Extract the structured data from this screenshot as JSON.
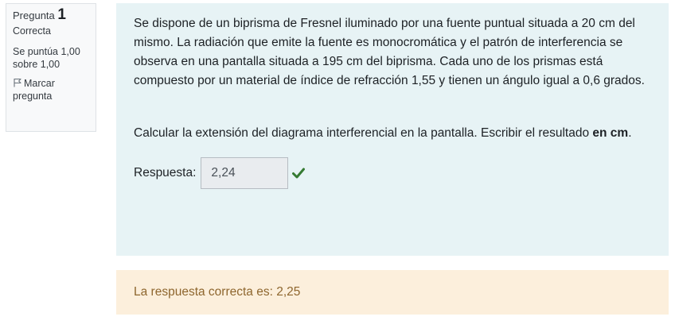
{
  "question_info": {
    "number_label": "Pregunta",
    "number": "1",
    "state": "Correcta",
    "grade": "Se puntúa 1,00 sobre 1,00",
    "flag_label": "Marcar pregunta",
    "flag_icon": "flag-outline-icon"
  },
  "question": {
    "statement": "Se dispone de un biprisma de Fresnel iluminado por una fuente puntual situada a 20 cm del mismo. La radiación que emite la fuente es monocromática y el patrón de interferencia se observa en una pantalla situada a 195 cm del biprisma. Cada uno de los prismas está compuesto por un material de índice de refracción 1,55 y tienen un ángulo igual a 0,6 grados.",
    "task_prefix": "Calcular la extensión del diagrama interferencial en la pantalla. Escribir el resultado ",
    "task_bold": "en cm",
    "task_suffix": ".",
    "answer_label": "Respuesta:",
    "answer_value": "2,24",
    "answer_status_icon": "check-icon",
    "status_color": "#357a32"
  },
  "feedback": {
    "right_answer": "La respuesta correcta es: 2,25"
  },
  "colors": {
    "formulation_bg": "#e7f3f5",
    "feedback_bg": "#fcefdc",
    "feedback_text": "#8e662e"
  }
}
